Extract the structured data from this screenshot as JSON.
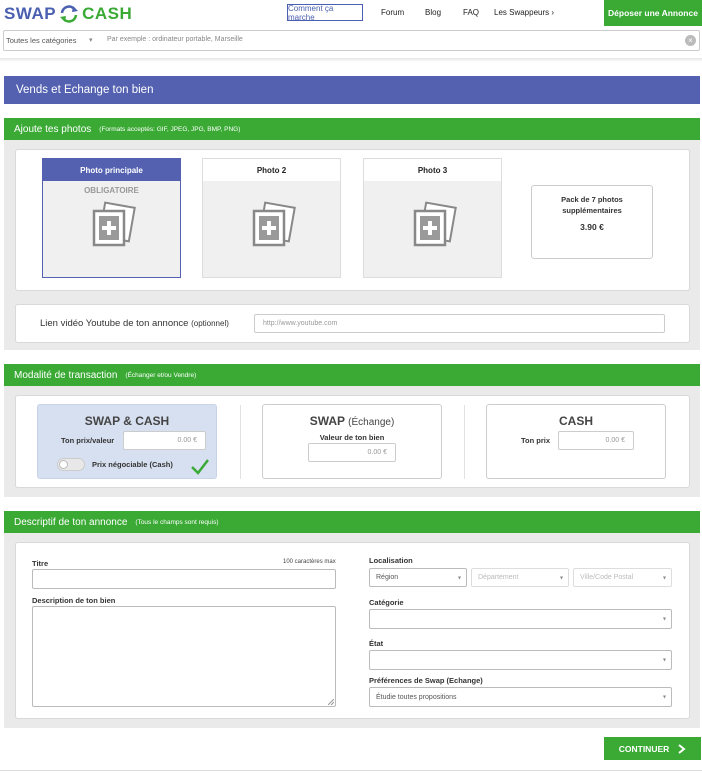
{
  "header": {
    "logo_left": "SWAP",
    "logo_right": "CASH",
    "how_it_works": "Comment ça marche",
    "nav": [
      "Forum",
      "Blog",
      "FAQ",
      "Les Swappeurs ›"
    ],
    "deposit_button": "Déposer une Annonce"
  },
  "search": {
    "category": "Toutes les catégories",
    "placeholder": "Par exemple : ordinateur portable, Marseille"
  },
  "page_title": "Vends et Echange ton bien",
  "photos": {
    "title": "Ajoute tes photos",
    "subtitle": "(Formats acceptés: GIF, JPEG, JPG, BMP, PNG)",
    "main_label": "Photo principale",
    "required_label": "OBLIGATOIRE",
    "photo2_label": "Photo 2",
    "photo3_label": "Photo 3",
    "pack_line1": "Pack de 7 photos",
    "pack_line2": "supplémentaires",
    "pack_price": "3.90 €",
    "video_label": "Lien vidéo Youtube de ton annonce",
    "video_optional": "(optionnel)",
    "video_placeholder": "http://www.youtube.com"
  },
  "transaction": {
    "title": "Modalité de transaction",
    "subtitle": "(Échanger et/ou Vendre)",
    "swapcash": {
      "title": "SWAP & CASH",
      "price_label": "Ton prix/valeur",
      "price_value": "0.00 €",
      "negotiable_label": "Prix négociable (Cash)"
    },
    "swap": {
      "title": "SWAP",
      "title_paren": "(Échange)",
      "value_label": "Valeur de ton bien",
      "value": "0.00 €"
    },
    "cash": {
      "title": "CASH",
      "price_label": "Ton prix",
      "price_value": "0.00 €"
    },
    "colors": {
      "active_card": "#d7e0f0",
      "check": "#3aaa35"
    }
  },
  "descriptif": {
    "title": "Descriptif de ton annonce",
    "subtitle": "(Tous le champs sont requis)",
    "titre_label": "Titre",
    "max_chars": "100 caractères max",
    "description_label": "Description de ton bien",
    "localisation_label": "Localisation",
    "region": "Région",
    "departement": "Département",
    "ville": "Ville/Code Postal",
    "categorie_label": "Catégorie",
    "etat_label": "État",
    "preferences_label": "Préférences de Swap (Echange)",
    "preferences_value": "Étudie toutes propositions"
  },
  "continue_button": "CONTINUER",
  "colors": {
    "green": "#3aaa35",
    "blue": "#5361b0"
  }
}
